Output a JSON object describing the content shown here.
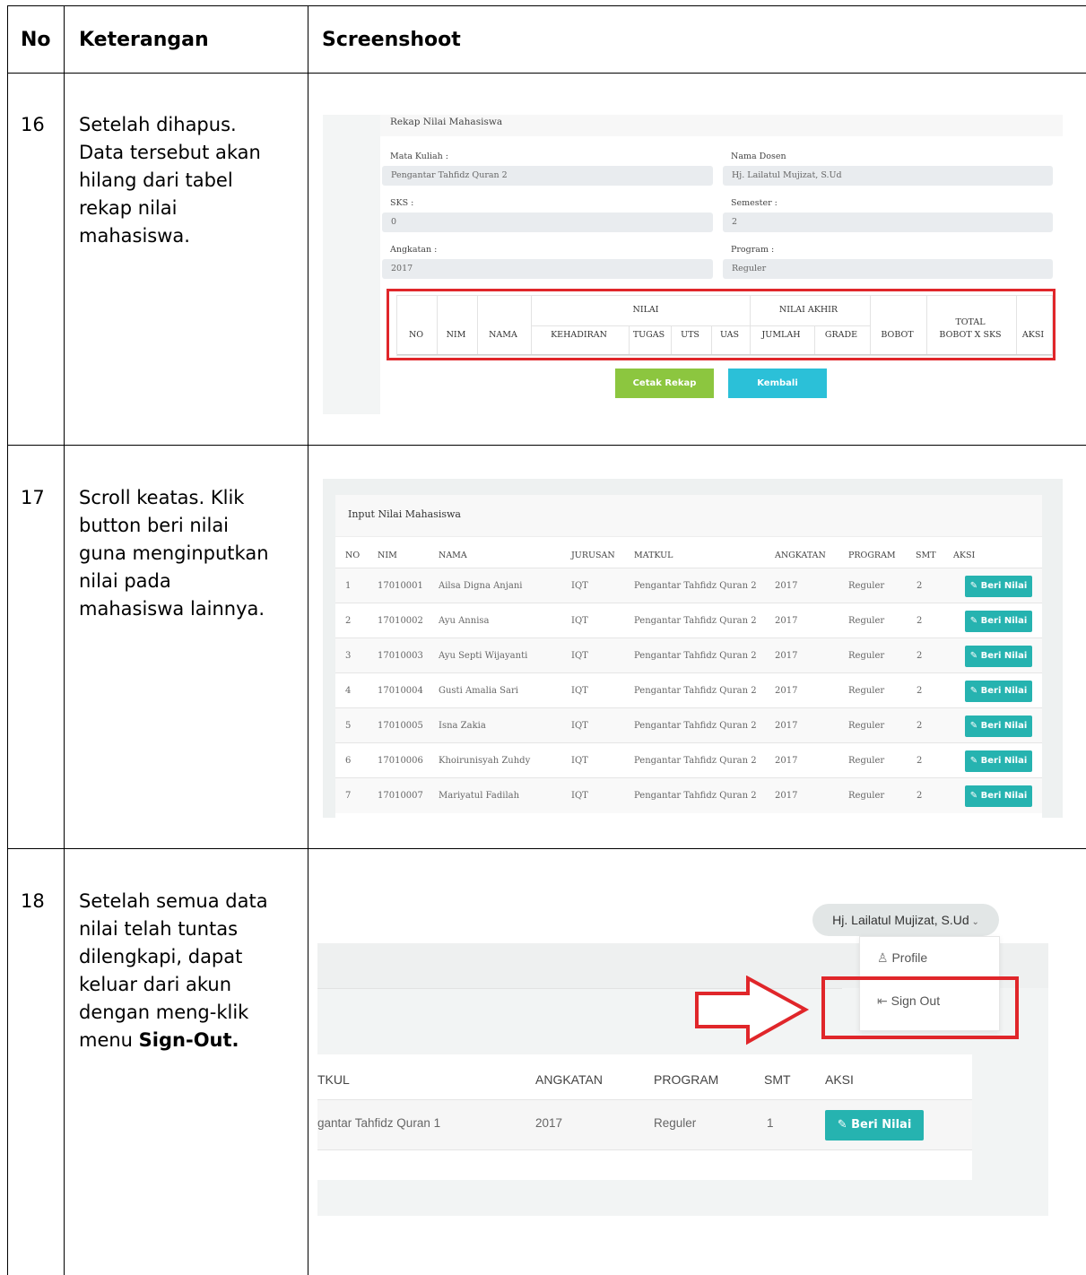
{
  "header": {
    "no": "No",
    "keterangan": "Keterangan",
    "screenshoot": "Screenshoot"
  },
  "rows": [
    {
      "no": "16",
      "desc_lines": [
        "Setelah dihapus.",
        "Data tersebut akan",
        "hilang dari tabel",
        "rekap nilai",
        "mahasiswa."
      ],
      "shot": {
        "title": "Rekap Nilai Mahasiswa",
        "fields": {
          "mata_kuliah_label": "Mata Kuliah :",
          "mata_kuliah_value": "Pengantar Tahfidz Quran 2",
          "nama_dosen_label": "Nama Dosen",
          "nama_dosen_value": "Hj. Lailatul Mujizat, S.Ud",
          "sks_label": "SKS :",
          "sks_value": "0",
          "semester_label": "Semester :",
          "semester_value": "2",
          "angkatan_label": "Angkatan :",
          "angkatan_value": "2017",
          "program_label": "Program :",
          "program_value": "Reguler"
        },
        "table": {
          "group_nilai": "NILAI",
          "group_nilai_akhir": "NILAI AKHIR",
          "cols": {
            "no": "NO",
            "nim": "NIM",
            "nama": "NAMA",
            "kehadiran": "KEHADIRAN",
            "tugas": "TUGAS",
            "uts": "UTS",
            "uas": "UAS",
            "jumlah": "JUMLAH",
            "grade": "GRADE",
            "bobot": "BOBOT",
            "total_1": "TOTAL",
            "total_2": "BOBOT X SKS",
            "aksi": "AKSI"
          }
        },
        "buttons": {
          "cetak": "Cetak Rekap",
          "kembali": "Kembali"
        }
      }
    },
    {
      "no": "17",
      "desc_lines": [
        "Scroll keatas. Klik",
        "button beri nilai",
        "guna menginputkan",
        "nilai pada",
        "mahasiswa lainnya."
      ],
      "shot": {
        "title": "Input Nilai Mahasiswa",
        "columns": [
          "NO",
          "NIM",
          "NAMA",
          "JURUSAN",
          "MATKUL",
          "ANGKATAN",
          "PROGRAM",
          "SMT",
          "AKSI"
        ],
        "button_label": "Beri Nilai",
        "rows": [
          [
            "1",
            "17010001",
            "Ailsa Digna Anjani",
            "IQT",
            "Pengantar Tahfidz Quran 2",
            "2017",
            "Reguler",
            "2"
          ],
          [
            "2",
            "17010002",
            "Ayu Annisa",
            "IQT",
            "Pengantar Tahfidz Quran 2",
            "2017",
            "Reguler",
            "2"
          ],
          [
            "3",
            "17010003",
            "Ayu Septi Wijayanti",
            "IQT",
            "Pengantar Tahfidz Quran 2",
            "2017",
            "Reguler",
            "2"
          ],
          [
            "4",
            "17010004",
            "Gusti Amalia Sari",
            "IQT",
            "Pengantar Tahfidz Quran 2",
            "2017",
            "Reguler",
            "2"
          ],
          [
            "5",
            "17010005",
            "Isna Zakia",
            "IQT",
            "Pengantar Tahfidz Quran 2",
            "2017",
            "Reguler",
            "2"
          ],
          [
            "6",
            "17010006",
            "Khoirunisyah Zuhdy",
            "IQT",
            "Pengantar Tahfidz Quran 2",
            "2017",
            "Reguler",
            "2"
          ],
          [
            "7",
            "17010007",
            "Mariyatul Fadilah",
            "IQT",
            "Pengantar Tahfidz Quran 2",
            "2017",
            "Reguler",
            "2"
          ]
        ]
      }
    },
    {
      "no": "18",
      "desc_lines": [
        "Setelah semua data",
        "nilai telah tuntas",
        "dilengkapi, dapat",
        "keluar dari akun",
        "dengan meng-klik"
      ],
      "desc_last_prefix": "menu ",
      "desc_last_bold": "Sign-Out.",
      "shot": {
        "user_menu": "Hj. Lailatul Mujizat, S.Ud",
        "menu_profile": "Profile",
        "menu_signout": "Sign Out",
        "columns": {
          "matkul": "TKUL",
          "angkatan": "ANGKATAN",
          "program": "PROGRAM",
          "smt": "SMT",
          "aksi": "AKSI"
        },
        "row": {
          "matkul": "gantar Tahfidz Quran 1",
          "angkatan": "2017",
          "program": "Reguler",
          "smt": "1"
        },
        "button_label": "Beri Nilai"
      }
    }
  ],
  "colors": {
    "highlight": "#e0262a",
    "green_button": "#8cc63f",
    "teal_button": "#26b3b0",
    "cyan_button": "#2bc0d8"
  }
}
